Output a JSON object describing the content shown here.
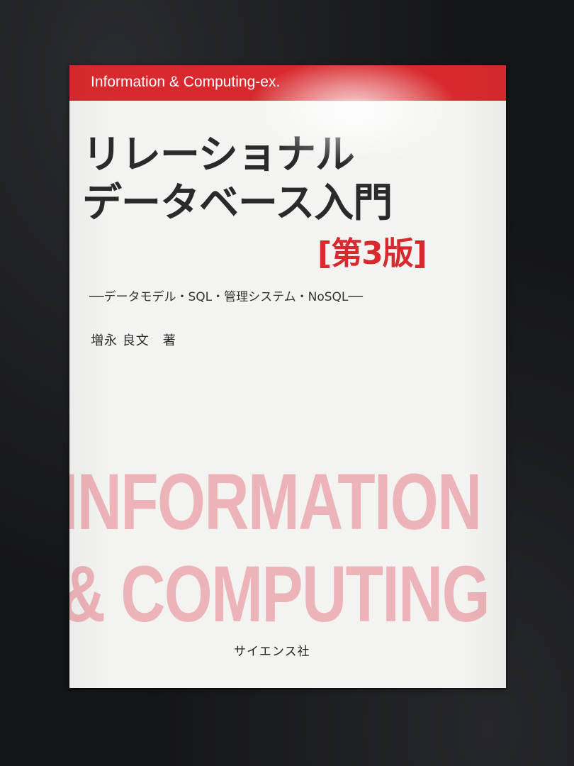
{
  "book": {
    "series": "Information & Computing-ex.",
    "title_line1": "リレーショナル",
    "title_line2": "データベース入門",
    "edition": "[第3版]",
    "subtitle": "──データモデル・SQL・管理システム・NoSQL──",
    "author": "増永 良文　著",
    "big_line1": "INFORMATION",
    "big_line2": "& COMPUTING",
    "publisher": "サイエンス社"
  },
  "colors": {
    "band": "#d82a2e",
    "edition": "#d82a2e",
    "big_text": "#ecb3b8",
    "cover": "#f3f3f1",
    "background": "#141517"
  }
}
